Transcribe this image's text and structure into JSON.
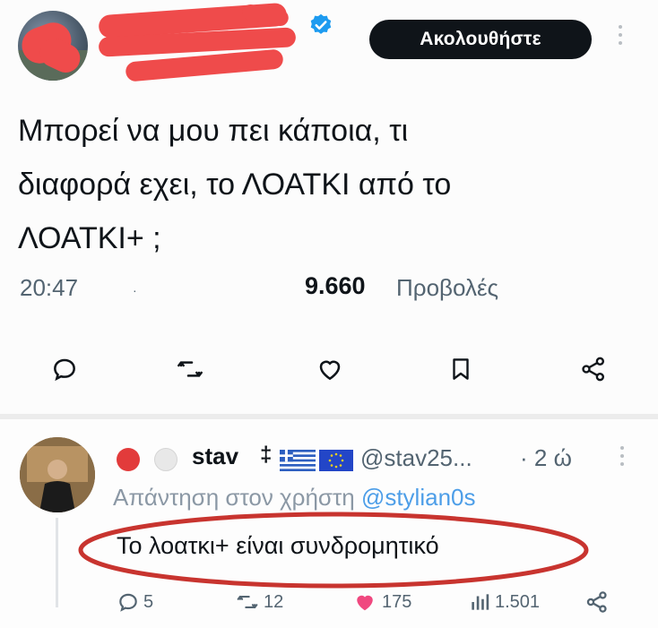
{
  "post": {
    "follow_label": "Ακολουθήστε",
    "text_line1": "Μπορεί να μου πει κάποια, τι",
    "text_line2": "διαφορά εχει, το ΛΟΑΤΚΙ από το",
    "text_line3": "ΛΟΑΤΚΙ+ ;",
    "time": "20:47",
    "dot": "·",
    "views_count": "9.660",
    "views_label": "Προβολές",
    "icons": [
      "reply-icon",
      "retweet-icon",
      "like-icon",
      "bookmark-icon",
      "share-icon"
    ]
  },
  "reply": {
    "display_name": "stav",
    "name_symbol": "‡",
    "handle": "@stav25...",
    "time": "· 2 ώ",
    "reply_to_prefix": "Απάντηση στον χρήστη ",
    "reply_to_mention": "@stylian0s",
    "text": "Το λοατκι+ είναι συνδρομητικό",
    "stats": {
      "replies": "5",
      "retweets": "12",
      "likes": "175",
      "views": "1.501"
    }
  },
  "colors": {
    "follow_bg": "#0f1419",
    "verified": "#1d9bf0",
    "redaction": "#ef4b4b",
    "annotation_ellipse": "#c8342f",
    "mention": "#4d9ee8",
    "like": "#f0487f"
  }
}
